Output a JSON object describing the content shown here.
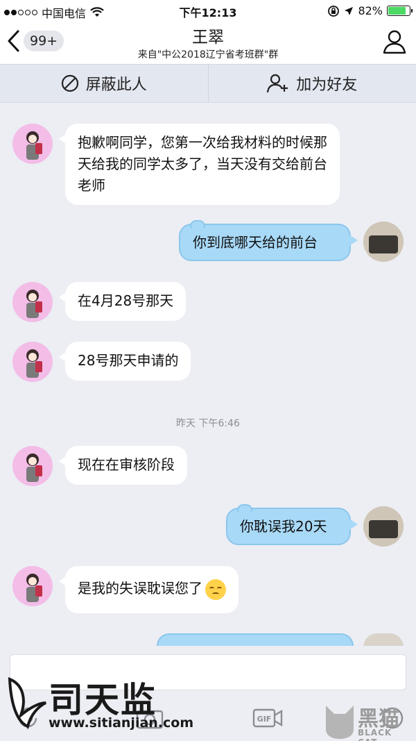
{
  "status_bar": {
    "carrier": "中国电信",
    "time": "下午12:13",
    "battery_percent": "82%",
    "battery_level": 0.82
  },
  "header": {
    "back_badge": "99+",
    "title": "王翠",
    "subtitle": "来自\"中公2018辽宁省考班群\"群"
  },
  "actions": {
    "block_label": "屏蔽此人",
    "add_friend_label": "加为好友"
  },
  "messages": [
    {
      "direction": "in",
      "text": "抱歉啊同学，您第一次给我材料的时候那天给我的同学太多了，当天没有交给前台老师"
    },
    {
      "direction": "out",
      "text": "你到底哪天给的前台"
    },
    {
      "direction": "in",
      "text": "在4月28号那天"
    },
    {
      "direction": "in",
      "text": "28号那天申请的"
    },
    {
      "direction": "in",
      "text": "现在在审核阶段"
    },
    {
      "direction": "out",
      "text": "你耽误我20天"
    },
    {
      "direction": "in",
      "text": "是我的失误耽误您了",
      "emoji": "disappointed-face"
    }
  ],
  "timestamp": "昨天 下午6:46",
  "toolbar": {
    "gif_label": "GIF"
  },
  "watermarks": {
    "left_brand": "司天监",
    "left_url": "www.sitianjian.com",
    "right_brand": "黑猫",
    "right_brand_en": "BLACK CAT"
  },
  "colors": {
    "incoming_bubble": "#ffffff",
    "outgoing_bubble": "#a8d9f7",
    "background": "#eceef3",
    "incoming_avatar": "#f3bde8"
  }
}
